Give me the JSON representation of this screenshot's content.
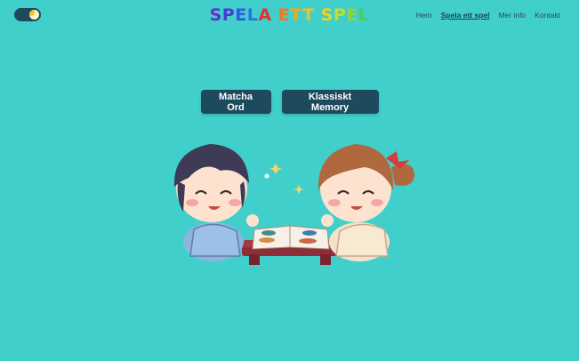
{
  "header": {
    "theme_toggle": {
      "state": "dark-mode-off",
      "icon": "moon-icon"
    },
    "title_letters": [
      {
        "ch": "S",
        "color": "#6A2BC9"
      },
      {
        "ch": "P",
        "color": "#4A3BD6"
      },
      {
        "ch": "E",
        "color": "#3458E0"
      },
      {
        "ch": "L",
        "color": "#2F6FE6"
      },
      {
        "ch": "A",
        "color": "#E23232"
      },
      {
        "ch": " ",
        "color": "#000000"
      },
      {
        "ch": "E",
        "color": "#F07A1A"
      },
      {
        "ch": "T",
        "color": "#F2A81C"
      },
      {
        "ch": "T",
        "color": "#F4C020"
      },
      {
        "ch": " ",
        "color": "#000000"
      },
      {
        "ch": "S",
        "color": "#F2D21E"
      },
      {
        "ch": "P",
        "color": "#C9DD2A"
      },
      {
        "ch": "E",
        "color": "#8FD640"
      },
      {
        "ch": "L",
        "color": "#4CCB5A"
      }
    ],
    "nav": [
      {
        "label": "Hem",
        "active": false
      },
      {
        "label": "Spela ett spel",
        "active": true
      },
      {
        "label": "Mer info",
        "active": false
      },
      {
        "label": "Kontakt",
        "active": false
      }
    ]
  },
  "main": {
    "buttons": [
      {
        "label": "Matcha Ord"
      },
      {
        "label": "Klassiskt Memory"
      }
    ],
    "illustration": {
      "icon": "kids-playing-memory-illustration"
    }
  },
  "colors": {
    "background": "#40CFCB",
    "button": "#1E4A5E",
    "button_text": "#FFFFFF",
    "nav_text": "#2A4A58"
  }
}
